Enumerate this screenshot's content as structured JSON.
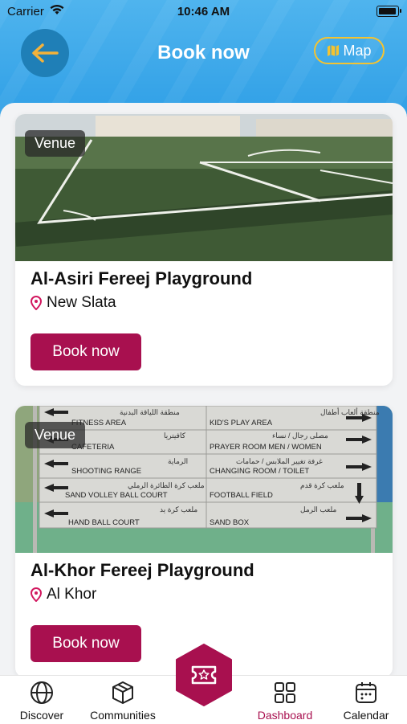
{
  "status": {
    "carrier": "Carrier",
    "time": "10:46 AM"
  },
  "header": {
    "title": "Book now",
    "map_label": "Map"
  },
  "venues": [
    {
      "badge": "Venue",
      "name": "Al-Asiri Fereej Playground",
      "location": "New Slata",
      "button": "Book now"
    },
    {
      "badge": "Venue",
      "name": "Al-Khor Fereej Playground",
      "location": "Al Khor",
      "button": "Book now"
    }
  ],
  "signboard": {
    "left": [
      "FITNESS AREA",
      "CAFETERIA",
      "SHOOTING RANGE",
      "SAND VOLLEY BALL COURT",
      "HAND BALL COURT"
    ],
    "right": [
      "KID'S PLAY AREA",
      "PRAYER ROOM MEN / WOMEN",
      "CHANGING ROOM / TOILET",
      "FOOTBALL FIELD",
      "SAND BOX"
    ]
  },
  "tabs": [
    {
      "label": "Discover",
      "icon": "globe-icon"
    },
    {
      "label": "Communities",
      "icon": "cube-icon"
    },
    {
      "label": "Dashboard",
      "icon": "grid-icon"
    },
    {
      "label": "Calendar",
      "icon": "calendar-icon"
    }
  ],
  "colors": {
    "header": "#2f9fe6",
    "accent": "#a8104f",
    "map_border": "#f4c331",
    "back_button": "#1f7fb7"
  }
}
